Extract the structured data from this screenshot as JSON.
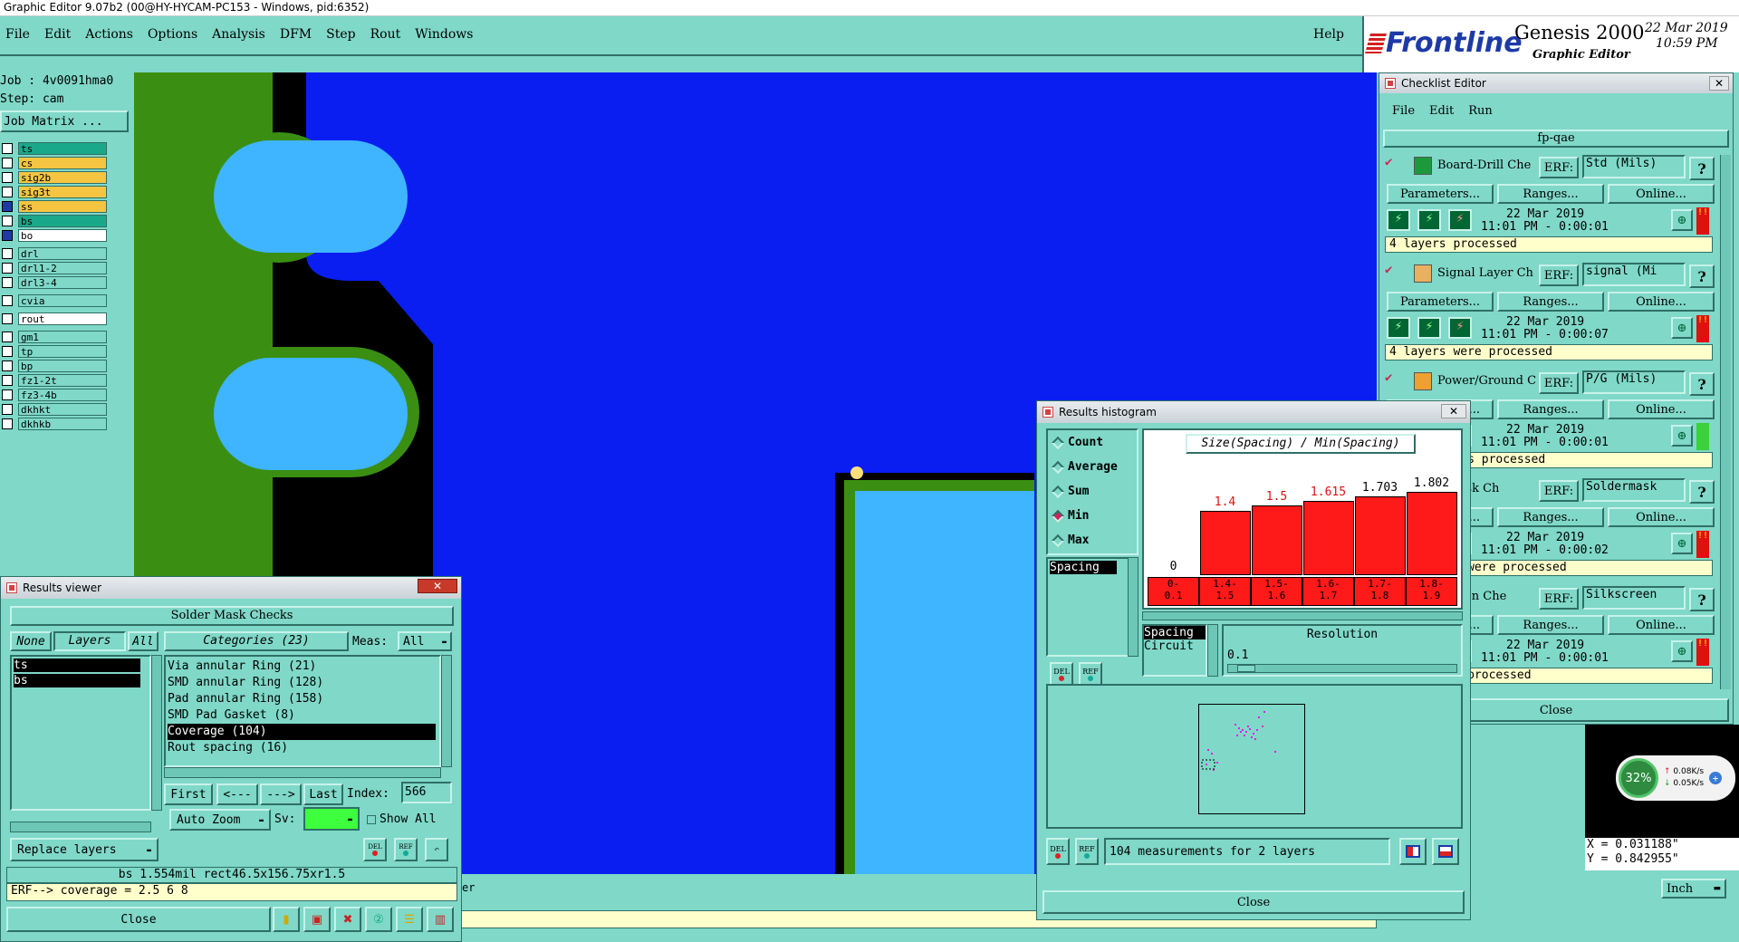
{
  "titlebar": {
    "title": "Graphic Editor 9.07b2 (00@HY-HYCAM-PC153 - Windows, pid:6352)"
  },
  "menu": {
    "items": [
      "File",
      "Edit",
      "Actions",
      "Options",
      "Analysis",
      "DFM",
      "Step",
      "Rout",
      "Windows"
    ],
    "help": "Help"
  },
  "brand": {
    "logo": "Frontline",
    "product": "Genesis 2000",
    "subtitle": "Graphic Editor",
    "date": "22 Mar 2019",
    "time": "10:59 PM"
  },
  "left": {
    "job": "Job : 4v0091hma0",
    "step": "Step: cam",
    "job_matrix": "Job Matrix ...",
    "layers_g1": [
      {
        "name": "ts",
        "color": "#1aa88a"
      },
      {
        "name": "cs",
        "color": "#f5c542"
      },
      {
        "name": "sig2b",
        "color": "#f5c542"
      },
      {
        "name": "sig3t",
        "color": "#f5c542"
      },
      {
        "name": "ss",
        "color": "#f5c542"
      },
      {
        "name": "bs",
        "color": "#1aa88a"
      },
      {
        "name": "bo",
        "color": "#ffffff"
      }
    ],
    "layers_g2": [
      "drl",
      "drl1-2",
      "drl3-4"
    ],
    "layers_g3": [
      "cvia"
    ],
    "layers_g4": [
      "rout"
    ],
    "layers_g5": [
      "gm1",
      "tp",
      "bp",
      "fz1-2t",
      "fz3-4b",
      "dkhkt",
      "dkhkb"
    ]
  },
  "checklist": {
    "title": "Checklist Editor",
    "menu": [
      "File",
      "Edit",
      "Run"
    ],
    "name": "fp-qae",
    "checks": [
      {
        "name": "Board-Drill Che",
        "erf_label": "ERF:",
        "erf": "Std (Mils)",
        "date": "22 Mar 2019",
        "time": "11:01 PM - 0:00:01",
        "status": "4 layers processed"
      },
      {
        "name": "Signal Layer Ch",
        "erf_label": "ERF:",
        "erf": "signal (Mi",
        "date": "22 Mar 2019",
        "time": "11:01 PM - 0:00:07",
        "status": "4 layers were processed"
      },
      {
        "name": "Power/Ground C",
        "erf_label": "ERF:",
        "erf": "P/G (Mils)",
        "date": "22 Mar 2019",
        "time": "11:01 PM - 0:00:01",
        "status": "round layers processed"
      },
      {
        "name": "r Mask Ch",
        "erf_label": "ERF:",
        "erf": "Soldermask",
        "date": "22 Mar 2019",
        "time": "11:01 PM - 0:00:02",
        "status": "ask layers were processed"
      },
      {
        "name": "Screen Che",
        "erf_label": "ERF:",
        "erf": "Silkscreen",
        "date": "22 Mar 2019",
        "time": "11:01 PM - 0:00:01",
        "status": "een layers processed"
      }
    ],
    "btn_params": "Parameters...",
    "btn_ranges": "Ranges...",
    "btn_online": "Online...",
    "close": "Close"
  },
  "histogram": {
    "title": "Results histogram",
    "options": [
      "Count",
      "Average",
      "Sum",
      "Min",
      "Max"
    ],
    "selected": "Min",
    "list": [
      "Spacing"
    ],
    "chart_title": "Size(Spacing) / Min(Spacing)",
    "bins": [
      "0-\n0.1",
      "1.4-\n1.5",
      "1.5-\n1.6",
      "1.6-\n1.7",
      "1.7-\n1.8",
      "1.8-\n1.9"
    ],
    "values": [
      "0",
      "1.4",
      "1.5",
      "1.615",
      "1.703",
      "1.802"
    ],
    "categories": [
      "Spacing",
      "Circuit"
    ],
    "resolution_label": "Resolution",
    "resolution": "0.1",
    "footer": "104 measurements for 2 layers",
    "close": "Close",
    "del": "DEL",
    "ref": "REF"
  },
  "results": {
    "title": "Results viewer",
    "header": "Solder Mask Checks",
    "none": "None",
    "layers": "Layers",
    "all": "All",
    "categories_label": "Categories (23)",
    "meas_label": "Meas:",
    "meas_value": "All",
    "layer_list": [
      "ts",
      "bs"
    ],
    "cat_list": [
      "Via annular Ring (21)",
      "SMD annular Ring (128)",
      "Pad annular Ring (158)",
      "SMD Pad Gasket (8)",
      "Coverage (104)",
      "Rout spacing (16)"
    ],
    "selected_cat": "Coverage (104)",
    "first": "First",
    "prev": "<---",
    "next": "--->",
    "last": "Last",
    "index_label": "Index:",
    "index_value": "566",
    "zoom": "Auto Zoom",
    "sv": "Sv:",
    "show_all": "Show All",
    "replace": "Replace layers",
    "status1": "bs 1.554mil  rect46.5x156.75xr1.5",
    "status2": "ERF--> coverage = 2.5 6 8",
    "close": "Close"
  },
  "statusbar": {
    "coord_x": "X = 0.031188\"",
    "coord_y": "Y = 0.842955\"",
    "units": "Inch",
    "hint": "er"
  },
  "net": {
    "percent": "32%",
    "up": "0.08K/s",
    "down": "0.05K/s"
  }
}
